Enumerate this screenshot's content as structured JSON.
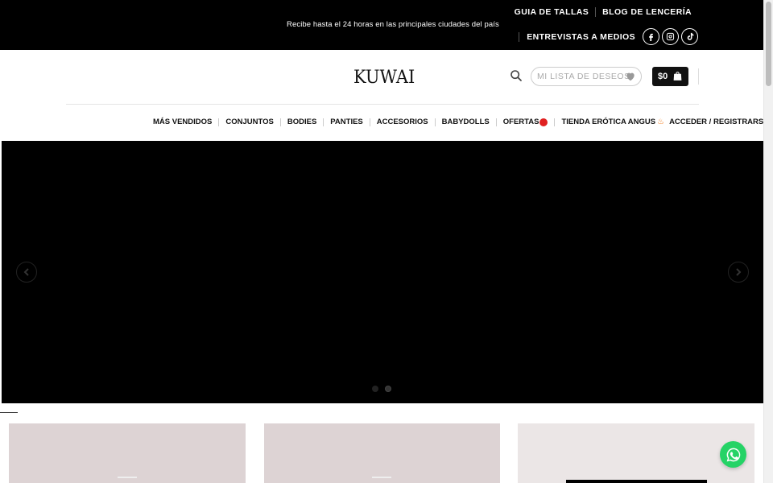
{
  "topbar": {
    "promo": "Recibe hasta el 24 horas en las principales ciudades del país",
    "links": [
      "GUIA DE TALLAS",
      "BLOG DE LENCERÍA"
    ],
    "media_link": "ENTREVISTAS A MEDIOS",
    "social_icons": [
      "facebook-icon",
      "instagram-icon",
      "tiktok-icon"
    ]
  },
  "header": {
    "logo": "KUWAI",
    "wishlist_label": "MI LISTA DE DESEOS",
    "cart_amount": "$0"
  },
  "nav": {
    "items": [
      "MÁS VENDIDOS",
      "CONJUNTOS",
      "BODIES",
      "PANTIES",
      "ACCESORIOS",
      "BABYDOLLS",
      "OFERTAS",
      "TIENDA ERÓTICA ANGUS",
      "ACCEDER / REGISTRARSE"
    ]
  },
  "slider": {
    "slide_count": 2,
    "active_slide": 2
  },
  "colors": {
    "topbar_bg": "#000000",
    "whatsapp": "#25d366",
    "card_bg": "#ddd3d4",
    "offer_dot": "#e02020"
  }
}
